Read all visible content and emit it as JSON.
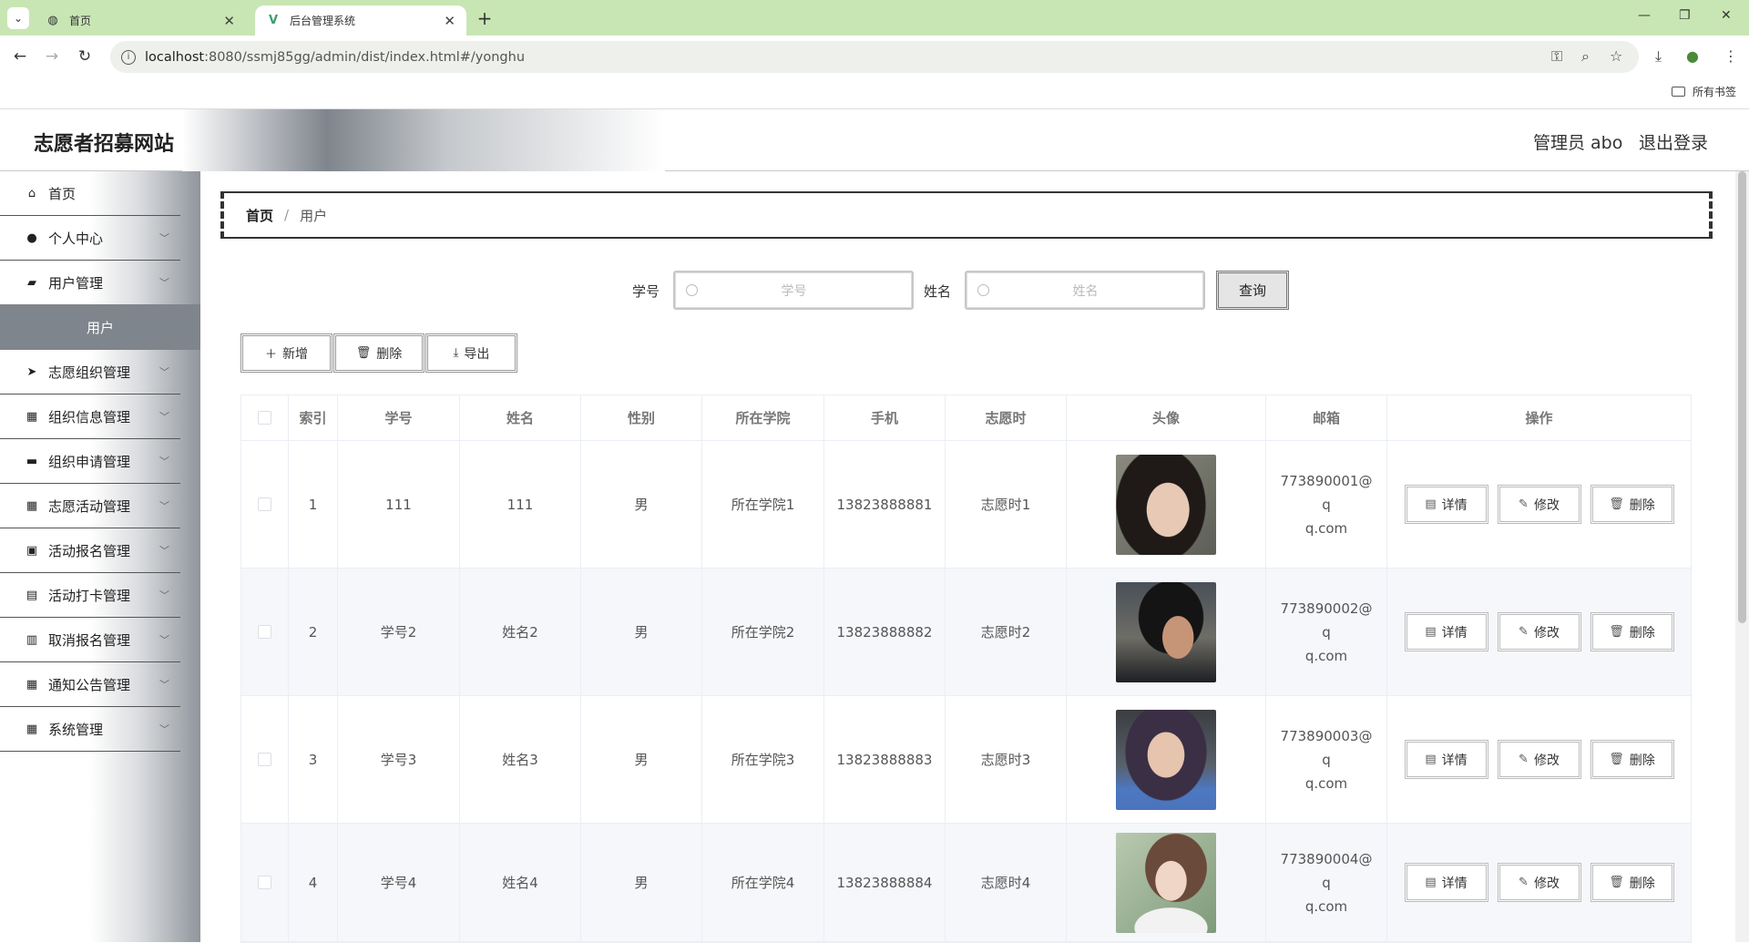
{
  "browser": {
    "tabs": [
      {
        "title": "首页",
        "icon": "globe-icon"
      },
      {
        "title": "后台管理系统",
        "icon": "vue-logo-icon"
      }
    ],
    "url_host": "localhost",
    "url_path": ":8080/ssmj85gg/admin/dist/index.html#/yonghu",
    "bookmarks_folder": "所有书签"
  },
  "header": {
    "site_title": "志愿者招募网站",
    "admin_label": "管理员 abo",
    "logout_label": "退出登录"
  },
  "sidebar": {
    "items": [
      {
        "label": "首页",
        "icon": "home-icon"
      },
      {
        "label": "个人中心",
        "icon": "user-icon"
      },
      {
        "label": "用户管理",
        "icon": "briefcase-icon"
      },
      {
        "label": "志愿组织管理",
        "icon": "send-icon"
      },
      {
        "label": "组织信息管理",
        "icon": "grid-icon"
      },
      {
        "label": "组织申请管理",
        "icon": "case-icon"
      },
      {
        "label": "志愿活动管理",
        "icon": "grid-icon"
      },
      {
        "label": "活动报名管理",
        "icon": "ticket-icon"
      },
      {
        "label": "活动打卡管理",
        "icon": "printer-icon"
      },
      {
        "label": "取消报名管理",
        "icon": "clipboard-icon"
      },
      {
        "label": "通知公告管理",
        "icon": "grid-icon"
      },
      {
        "label": "系统管理",
        "icon": "grid-icon"
      }
    ],
    "active_sub": "用户"
  },
  "breadcrumb": {
    "home": "首页",
    "separator": "/",
    "current": "用户"
  },
  "search": {
    "field1_label": "学号",
    "field1_placeholder": "学号",
    "field2_label": "姓名",
    "field2_placeholder": "姓名",
    "query_button": "查询"
  },
  "actions": {
    "add": "新增",
    "delete": "删除",
    "export": "导出"
  },
  "table": {
    "headers": [
      "索引",
      "学号",
      "姓名",
      "性别",
      "所在学院",
      "手机",
      "志愿时",
      "头像",
      "邮箱",
      "操作"
    ],
    "rows": [
      {
        "index": "1",
        "xuehao": "111",
        "name": "111",
        "gender": "男",
        "college": "所在学院1",
        "phone": "13823888881",
        "hours": "志愿时1",
        "email_line1": "773890001@q",
        "email_line2": "q.com"
      },
      {
        "index": "2",
        "xuehao": "学号2",
        "name": "姓名2",
        "gender": "男",
        "college": "所在学院2",
        "phone": "13823888882",
        "hours": "志愿时2",
        "email_line1": "773890002@q",
        "email_line2": "q.com"
      },
      {
        "index": "3",
        "xuehao": "学号3",
        "name": "姓名3",
        "gender": "男",
        "college": "所在学院3",
        "phone": "13823888883",
        "hours": "志愿时3",
        "email_line1": "773890003@q",
        "email_line2": "q.com"
      },
      {
        "index": "4",
        "xuehao": "学号4",
        "name": "姓名4",
        "gender": "男",
        "college": "所在学院4",
        "phone": "13823888884",
        "hours": "志愿时4",
        "email_line1": "773890004@q",
        "email_line2": "q.com"
      }
    ],
    "row_actions": {
      "detail": "详情",
      "edit": "修改",
      "delete": "删除"
    }
  },
  "colors": {
    "tab_bar": "#c8e6b4",
    "sidebar_active": "#7f858c",
    "row_alt": "#f5f7fa"
  }
}
